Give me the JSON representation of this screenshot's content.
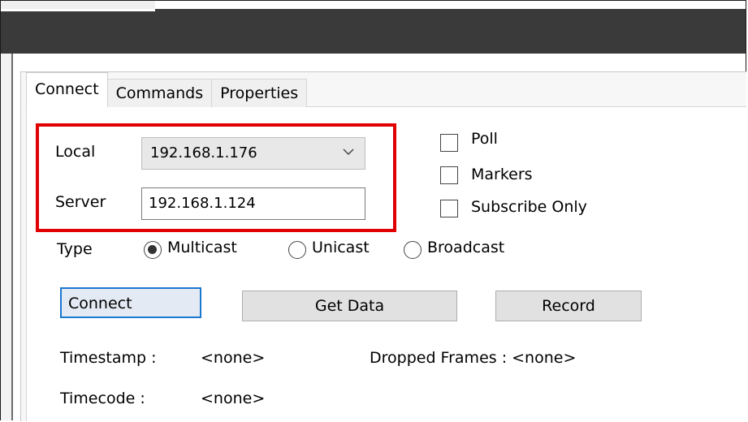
{
  "tabs": [
    {
      "label": "Connect",
      "active": true
    },
    {
      "label": "Commands",
      "active": false
    },
    {
      "label": "Properties",
      "active": false
    }
  ],
  "connection": {
    "local_label": "Local",
    "local_value": "192.168.1.176",
    "server_label": "Server",
    "server_value": "192.168.1.124"
  },
  "options": {
    "poll_label": "Poll",
    "markers_label": "Markers",
    "subscribe_only_label": "Subscribe Only"
  },
  "type": {
    "label": "Type",
    "multicast": "Multicast",
    "unicast": "Unicast",
    "broadcast": "Broadcast",
    "selected": "Multicast"
  },
  "buttons": {
    "connect": "Connect",
    "get_data": "Get Data",
    "record": "Record"
  },
  "status": {
    "timestamp_label": "Timestamp :",
    "timestamp_value": "<none>",
    "dropped_frames_label": "Dropped Frames : <none>",
    "timecode_label": "Timecode :",
    "timecode_value": "<none>"
  },
  "colors": {
    "highlight": "#e00000",
    "title_bar": "#3a3a3a",
    "primary_button_border": "#1a78d0"
  }
}
